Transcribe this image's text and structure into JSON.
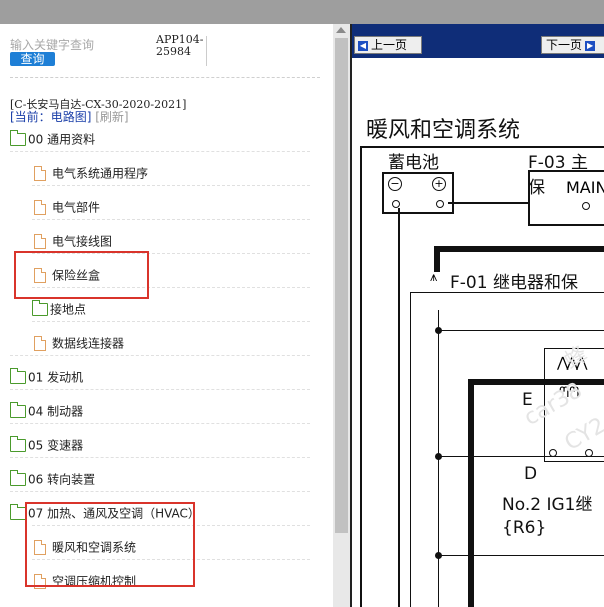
{
  "search": {
    "placeholder": "输入关键字查询",
    "button_label": "查询"
  },
  "app_code": "APP104-25984",
  "doc_id": "[C-长安马自达-CX-30-2020-2021]",
  "breadcrumb": {
    "prefix": "[当前：",
    "current": "电路图",
    "suffix": "]",
    "refresh": "[刷新]"
  },
  "tree": [
    {
      "label": "00 通用资料",
      "type": "folder"
    },
    {
      "label": "电气系统通用程序",
      "type": "file"
    },
    {
      "label": "电气部件",
      "type": "file"
    },
    {
      "label": "电气接线图",
      "type": "file"
    },
    {
      "label": "保险丝盒",
      "type": "file"
    },
    {
      "label": "接地点",
      "type": "folder"
    },
    {
      "label": "数据线连接器",
      "type": "file"
    },
    {
      "label": "01 发动机",
      "type": "folder"
    },
    {
      "label": "04 制动器",
      "type": "folder"
    },
    {
      "label": "05 变速器",
      "type": "folder"
    },
    {
      "label": "06 转向装置",
      "type": "folder"
    },
    {
      "label": "07 加热、通风及空调（HVAC）",
      "type": "folder"
    },
    {
      "label": "暖风和空调系统",
      "type": "file"
    },
    {
      "label": "空调压缩机控制",
      "type": "file"
    }
  ],
  "nav": {
    "prev_label": "上一页",
    "next_label": "下一页"
  },
  "document": {
    "title": "暖风和空调系统",
    "battery_label": "蓄电池",
    "f03_label": "F-03 主保",
    "main_label": "MAIN",
    "f01_label": "F-01  继电器和保",
    "e_label": "E",
    "d_label": "D",
    "relay_label": "No.2 IG1继",
    "relay_code": "{R6}",
    "watermark_1": "蜂",
    "watermark_2": "car38",
    "watermark_3": "CY2"
  },
  "colors": {
    "nav_bg": "#0f2d78",
    "query_btn": "#1e7fd6",
    "highlight": "#d9342b",
    "folder": "#4a9a2c",
    "file": "#e0a060"
  }
}
